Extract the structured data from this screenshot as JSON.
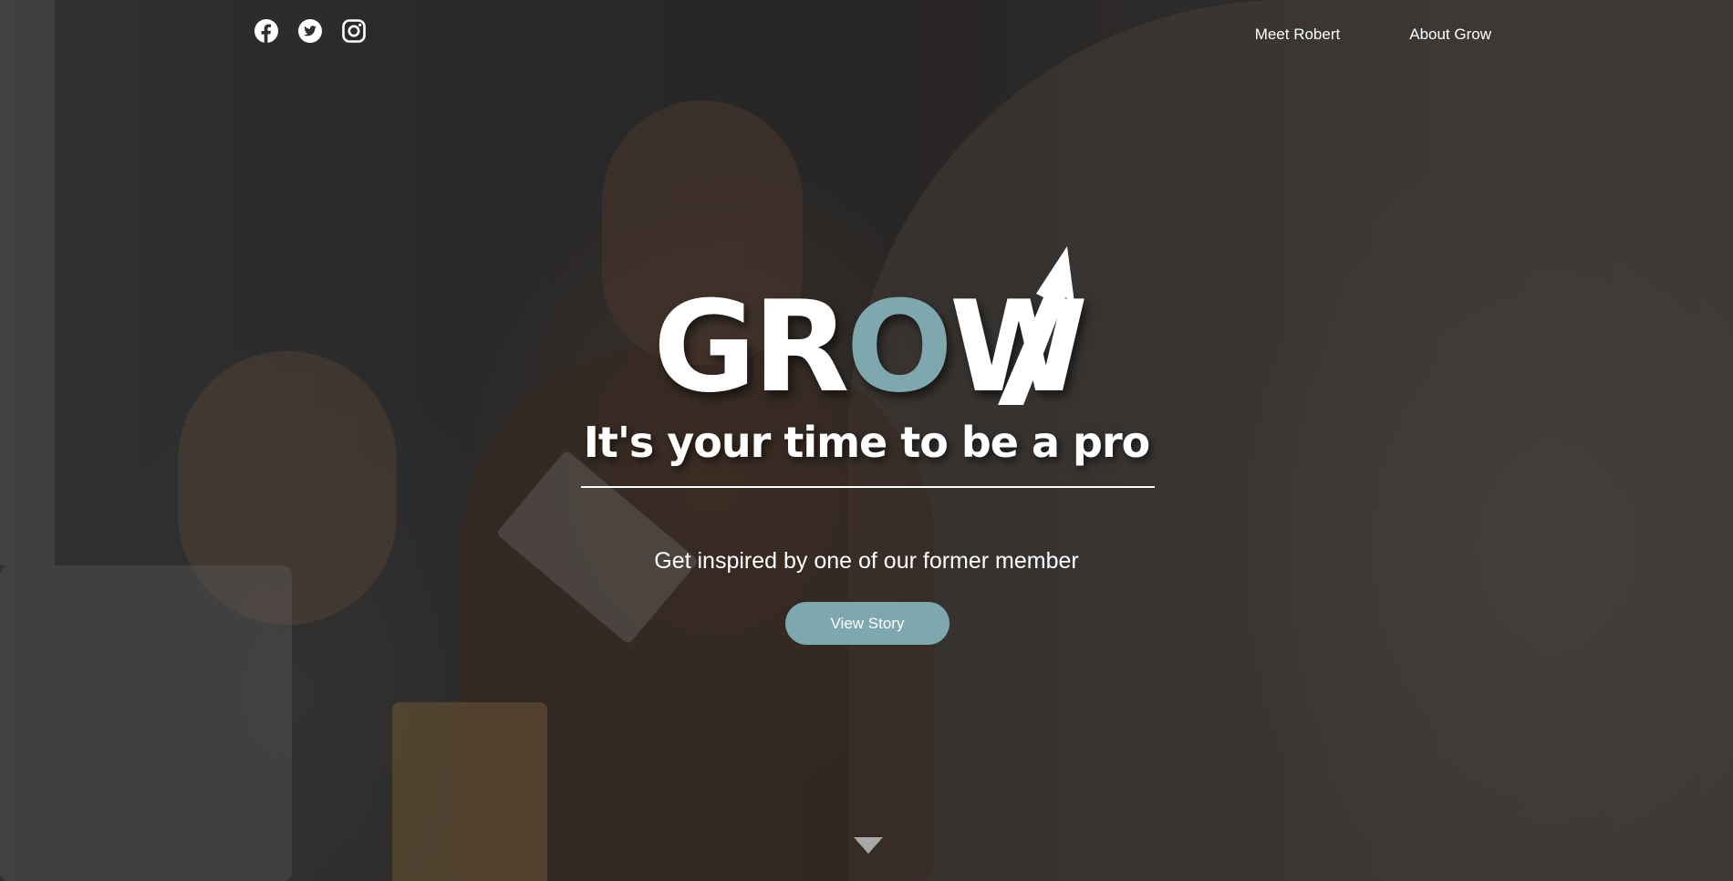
{
  "header": {
    "social": [
      {
        "name": "facebook",
        "icon": "facebook-icon"
      },
      {
        "name": "twitter",
        "icon": "twitter-icon"
      },
      {
        "name": "instagram",
        "icon": "instagram-icon"
      }
    ],
    "nav": [
      {
        "label": "Meet Robert"
      },
      {
        "label": "About Grow"
      }
    ]
  },
  "hero": {
    "logo": {
      "text_main": "GR",
      "text_accent": "O",
      "text_end": "W",
      "accent_color": "#7fa7ae",
      "icon": "arrow-up-icon"
    },
    "tagline": "It's your time to be a pro",
    "subtitle": "Get inspired by one of our former member",
    "cta_label": "View Story",
    "cta_color": "#7fa7ae",
    "scroll_icon": "triangle-down-icon"
  }
}
